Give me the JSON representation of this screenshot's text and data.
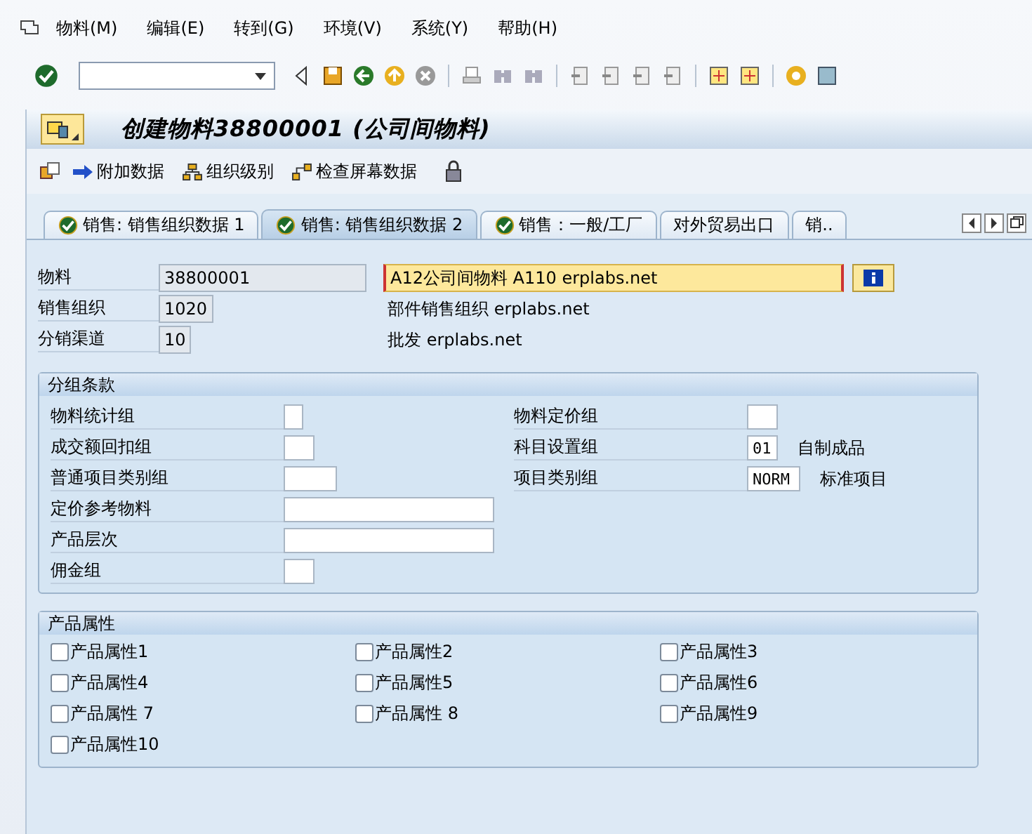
{
  "menu": [
    "物料(M)",
    "编辑(E)",
    "转到(G)",
    "环境(V)",
    "系统(Y)",
    "帮助(H)"
  ],
  "title": "创建物料38800001 (公司间物料)",
  "app_toolbar": [
    "附加数据",
    "组织级别",
    "检查屏幕数据"
  ],
  "tabs": [
    {
      "label": "销售: 销售组织数据 1",
      "selected": false,
      "kind": "checked"
    },
    {
      "label": "销售: 销售组织数据 2",
      "selected": true,
      "kind": "checked"
    },
    {
      "label": "销售：一般/工厂",
      "selected": false,
      "kind": "checked"
    },
    {
      "label": "对外贸易出口",
      "selected": false,
      "kind": "plain"
    },
    {
      "label": "销..",
      "selected": false,
      "kind": "plain"
    }
  ],
  "header": {
    "material_label": "物料",
    "material_value": "38800001",
    "description": "A12公司间物料 A110 erplabs.net",
    "sales_org_label": "销售组织",
    "sales_org_value": "1020",
    "sales_org_text": "部件销售组织 erplabs.net",
    "channel_label": "分销渠道",
    "channel_value": "10",
    "channel_text": "批发 erplabs.net"
  },
  "grouping": {
    "title": "分组条款",
    "left": [
      {
        "label": "物料统计组"
      },
      {
        "label": "成交额回扣组"
      },
      {
        "label": "普通项目类别组"
      },
      {
        "label": "定价参考物料"
      },
      {
        "label": "产品层次"
      },
      {
        "label": "佣金组"
      }
    ],
    "right": [
      {
        "label": "物料定价组"
      },
      {
        "label": "科目设置组",
        "value": "01",
        "text": "自制成品"
      },
      {
        "label": "项目类别组",
        "value": "NORM",
        "text": "标准项目"
      }
    ]
  },
  "attributes": {
    "title": "产品属性",
    "items": [
      {
        "label": "产品属性1",
        "checked": false
      },
      {
        "label": "产品属性2",
        "checked": false
      },
      {
        "label": "产品属性3",
        "checked": false
      },
      {
        "label": "产品属性4",
        "checked": false
      },
      {
        "label": "产品属性5",
        "checked": false
      },
      {
        "label": "产品属性6",
        "checked": false
      },
      {
        "label": "产品属性 7",
        "checked": false
      },
      {
        "label": "产品属性 8",
        "checked": false
      },
      {
        "label": "产品属性9",
        "checked": false
      },
      {
        "label": "产品属性10",
        "checked": false
      }
    ]
  }
}
